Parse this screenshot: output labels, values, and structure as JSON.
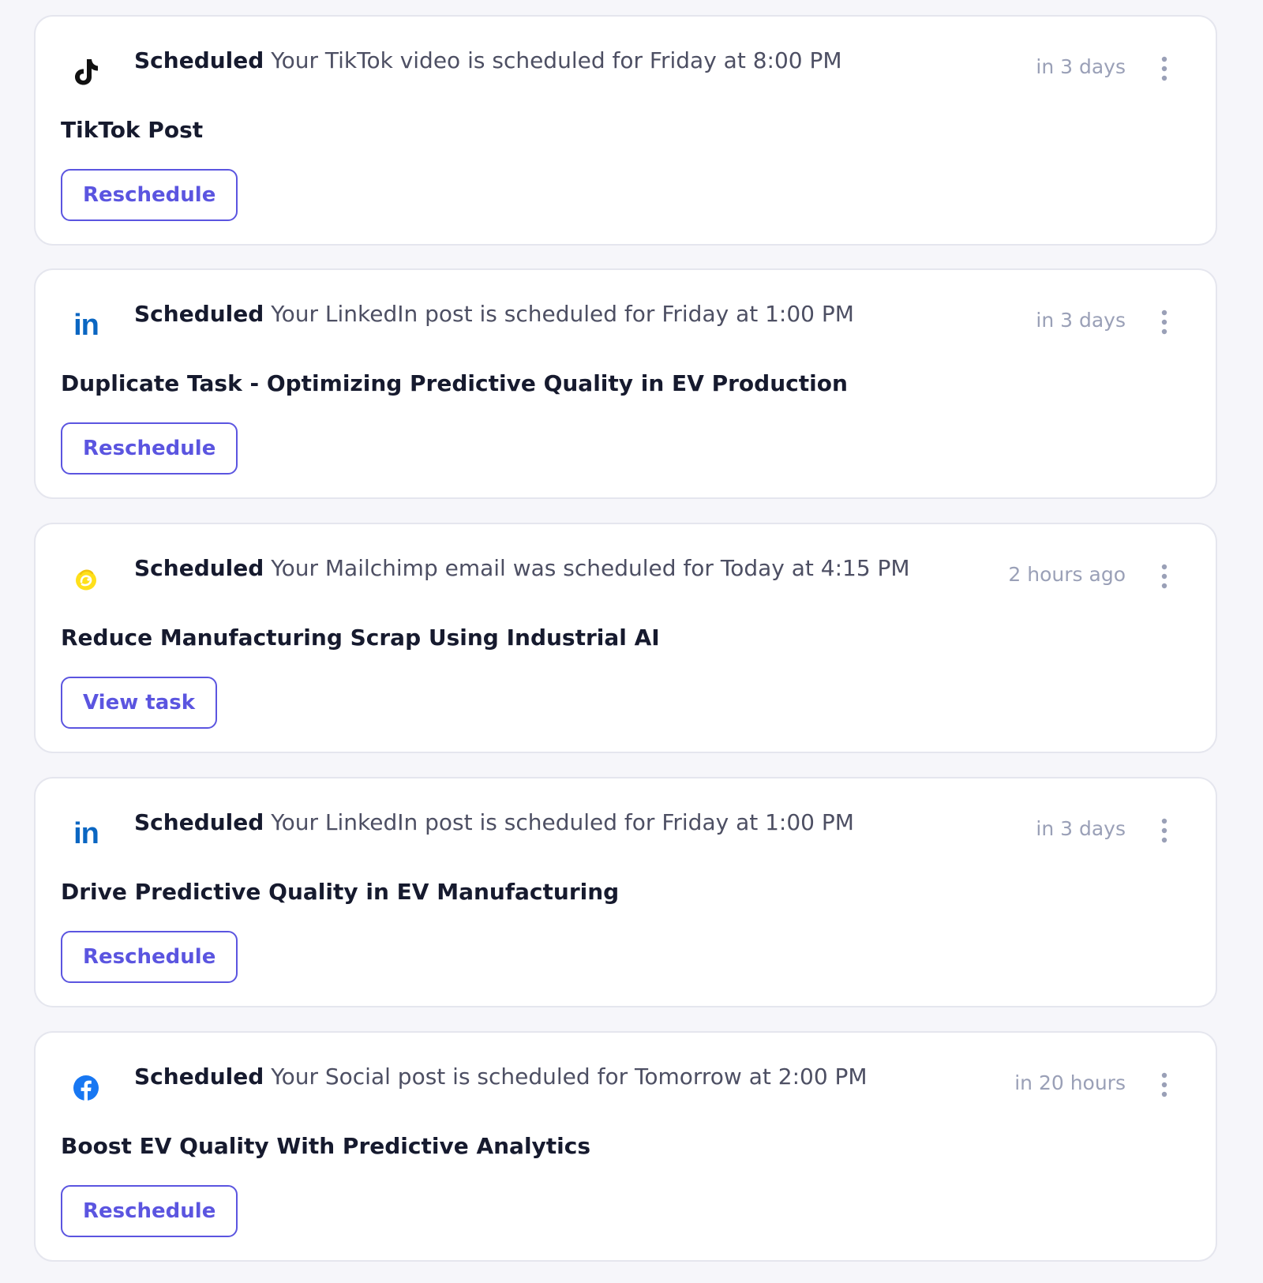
{
  "colors": {
    "background": "#f6f6fa",
    "accent": "#5b55e0",
    "linkedin": "#0a66c2",
    "facebook": "#1877f2",
    "mailchimp": "#ffe01b"
  },
  "notifications": [
    {
      "platform_icon": "tiktok-icon",
      "status_label": "Scheduled",
      "message": "Your TikTok video is scheduled for Friday at 8:00 PM",
      "time": "in 3 days",
      "title": "TikTok Post",
      "action_label": "Reschedule"
    },
    {
      "platform_icon": "linkedin-icon",
      "logo_text": "in",
      "status_label": "Scheduled",
      "message": "Your LinkedIn post is scheduled for Friday at 1:00 PM",
      "time": "in 3 days",
      "title": "Duplicate Task - Optimizing Predictive Quality in EV Production",
      "action_label": "Reschedule"
    },
    {
      "platform_icon": "mailchimp-icon",
      "status_label": "Scheduled",
      "message": "Your Mailchimp email was scheduled for Today at 4:15 PM",
      "time": "2 hours ago",
      "title": "Reduce Manufacturing Scrap Using Industrial AI",
      "action_label": "View task"
    },
    {
      "platform_icon": "linkedin-icon",
      "logo_text": "in",
      "status_label": "Scheduled",
      "message": "Your LinkedIn post is scheduled for Friday at 1:00 PM",
      "time": "in 3 days",
      "title": "Drive Predictive Quality in EV Manufacturing",
      "action_label": "Reschedule"
    },
    {
      "platform_icon": "facebook-icon",
      "status_label": "Scheduled",
      "message": "Your Social post is scheduled for Tomorrow at 2:00 PM",
      "time": "in 20 hours",
      "title": "Boost EV Quality With Predictive Analytics",
      "action_label": "Reschedule"
    }
  ]
}
